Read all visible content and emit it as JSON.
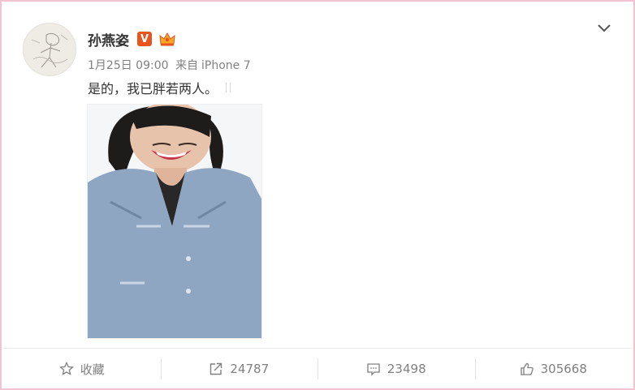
{
  "post": {
    "author": "孙燕姿",
    "verified_mark": "V",
    "time": "1月25日 09:00",
    "source_prefix": "来自",
    "source": "iPhone 7",
    "text": "是的，我已胖若两人。"
  },
  "actions": {
    "favorite_label": "收藏",
    "repost_count": "24787",
    "comment_count": "23498",
    "like_count": "305668"
  },
  "icons": {
    "avatar": "sketch-avatar",
    "verified": "verified-v-icon",
    "member": "crown-icon",
    "menu": "chevron-down-icon",
    "favorite": "star-icon",
    "repost": "share-arrow-icon",
    "comment": "comment-icon",
    "like": "thumbs-up-icon"
  },
  "colors": {
    "border": "#f2c4d2",
    "verified": "#e8541e",
    "text": "#333333",
    "muted": "#808080"
  }
}
